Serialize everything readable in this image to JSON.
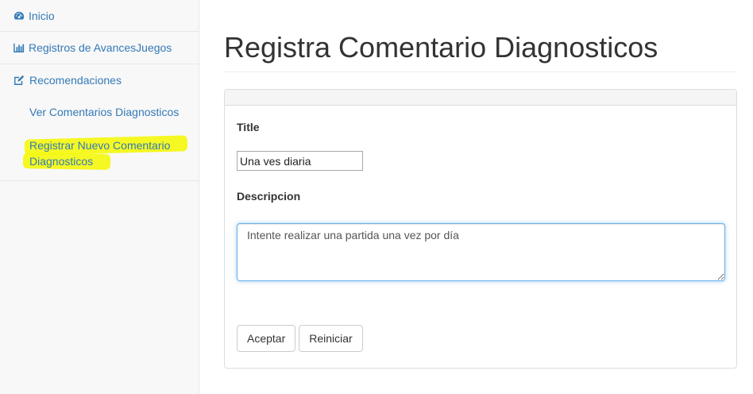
{
  "sidebar": {
    "items": [
      {
        "label": "Inicio",
        "icon": "dashboard-icon"
      },
      {
        "label": "Registros de AvancesJuegos",
        "icon": "bar-chart-icon"
      },
      {
        "label": "Recomendaciones",
        "icon": "edit-icon"
      }
    ],
    "subitems": [
      {
        "label": "Ver Comentarios Diagnosticos"
      },
      {
        "label": "Registrar Nuevo Comentario Diagnosticos"
      }
    ],
    "highlight_color": "#f4f70f",
    "link_color": "#337ab7"
  },
  "main": {
    "page_title": "Registra Comentario Diagnosticos",
    "form": {
      "title_label": "Title",
      "title_value": "Una ves diaria",
      "description_label": "Descripcion",
      "description_value": "Intente realizar una partida una vez por día",
      "accept_label": "Aceptar",
      "reset_label": "Reiniciar"
    }
  }
}
